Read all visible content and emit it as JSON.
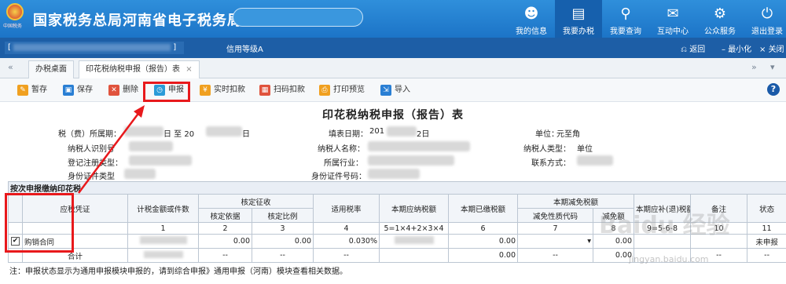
{
  "header": {
    "title": "国家税务总局河南省电子税务局",
    "logo_sub": "中国税务",
    "nav": [
      {
        "label": "我的信息",
        "icon": "user-icon"
      },
      {
        "label": "我要办税",
        "icon": "monitor-icon"
      },
      {
        "label": "我要查询",
        "icon": "search-doc-icon"
      },
      {
        "label": "互动中心",
        "icon": "chat-icon"
      },
      {
        "label": "公众服务",
        "icon": "service-icon"
      },
      {
        "label": "退出登录",
        "icon": "power-icon"
      }
    ]
  },
  "subbar": {
    "user_prefix": "[",
    "user_suffix": "]",
    "level": "信用等级A",
    "back": "返回",
    "minimize": "最小化",
    "close": "关闭"
  },
  "tabs": [
    {
      "label": "办税桌面"
    },
    {
      "label": "印花税纳税申报（报告）表"
    }
  ],
  "tab_close": "×",
  "toolbar": {
    "buttons": [
      {
        "label": "暂存",
        "color": "#f0a020"
      },
      {
        "label": "保存",
        "color": "#2a7fd4"
      },
      {
        "label": "删除",
        "color": "#e0533d"
      },
      {
        "label": "申报",
        "color": "#2a9bd8"
      },
      {
        "label": "实时扣款",
        "color": "#f0a020"
      },
      {
        "label": "扫码扣款",
        "color": "#e0533d"
      },
      {
        "label": "打印预览",
        "color": "#f0a020"
      },
      {
        "label": "导入",
        "color": "#2a7fd4"
      }
    ],
    "help": "?"
  },
  "form": {
    "title": "印花税纳税申报（报告）表",
    "period_label": "税（费）所属期：",
    "period_mid": "日 至 20",
    "period_end": "日",
    "fill_date_label": "填表日期：",
    "fill_date_value": "201",
    "fill_date_end": "2日",
    "unit_label": "单位：",
    "unit_value": "元至角",
    "taxpayer_id_label": "纳税人识别号",
    "taxpayer_name_label": "纳税人名称：",
    "taxpayer_type_label": "纳税人类型：",
    "taxpayer_type_value": "单位",
    "reg_type_label": "登记注册类型：",
    "industry_label": "所属行业：",
    "contact_label": "联系方式：",
    "id_type_label": "身份证件类型",
    "id_number_label": "身份证件号码："
  },
  "table": {
    "section": "按次申报缴纳印花税",
    "headers": {
      "voucher": "应税凭证",
      "amount": "计税金额或件数",
      "verified": "核定征收",
      "basis": "核定依据",
      "ratio": "核定比例",
      "rate": "适用税率",
      "payable": "本期应纳税额",
      "paid": "本期已缴税额",
      "relief": "本期减免税额",
      "relief_code": "减免性质代码",
      "relief_amount": "减免额",
      "refund": "本期应补(退)税额",
      "remark": "备注",
      "status": "状态"
    },
    "col_numbers": [
      "1",
      "2",
      "3",
      "4",
      "5=1×4+2×3×4",
      "6",
      "7",
      "8",
      "9=5-6-8",
      "10",
      "11"
    ],
    "rows": [
      {
        "checked": "✔",
        "name": "购销合同",
        "basis": "0.00",
        "ratio": "0.00",
        "rate": "0.030%",
        "paid": "0.00",
        "relief_amount": "0.00",
        "status": "未申报"
      }
    ],
    "total": {
      "label": "合计",
      "dash": "--",
      "paid": "0.00",
      "relief_amount": "0.00"
    }
  },
  "note": "注：申报状态显示为通用申报模块申报的，请到综合申报》通用申报（河南）模块查看相关数据。",
  "watermark": "Baidu 经验",
  "watermark_url": "jingyan.baidu.com"
}
